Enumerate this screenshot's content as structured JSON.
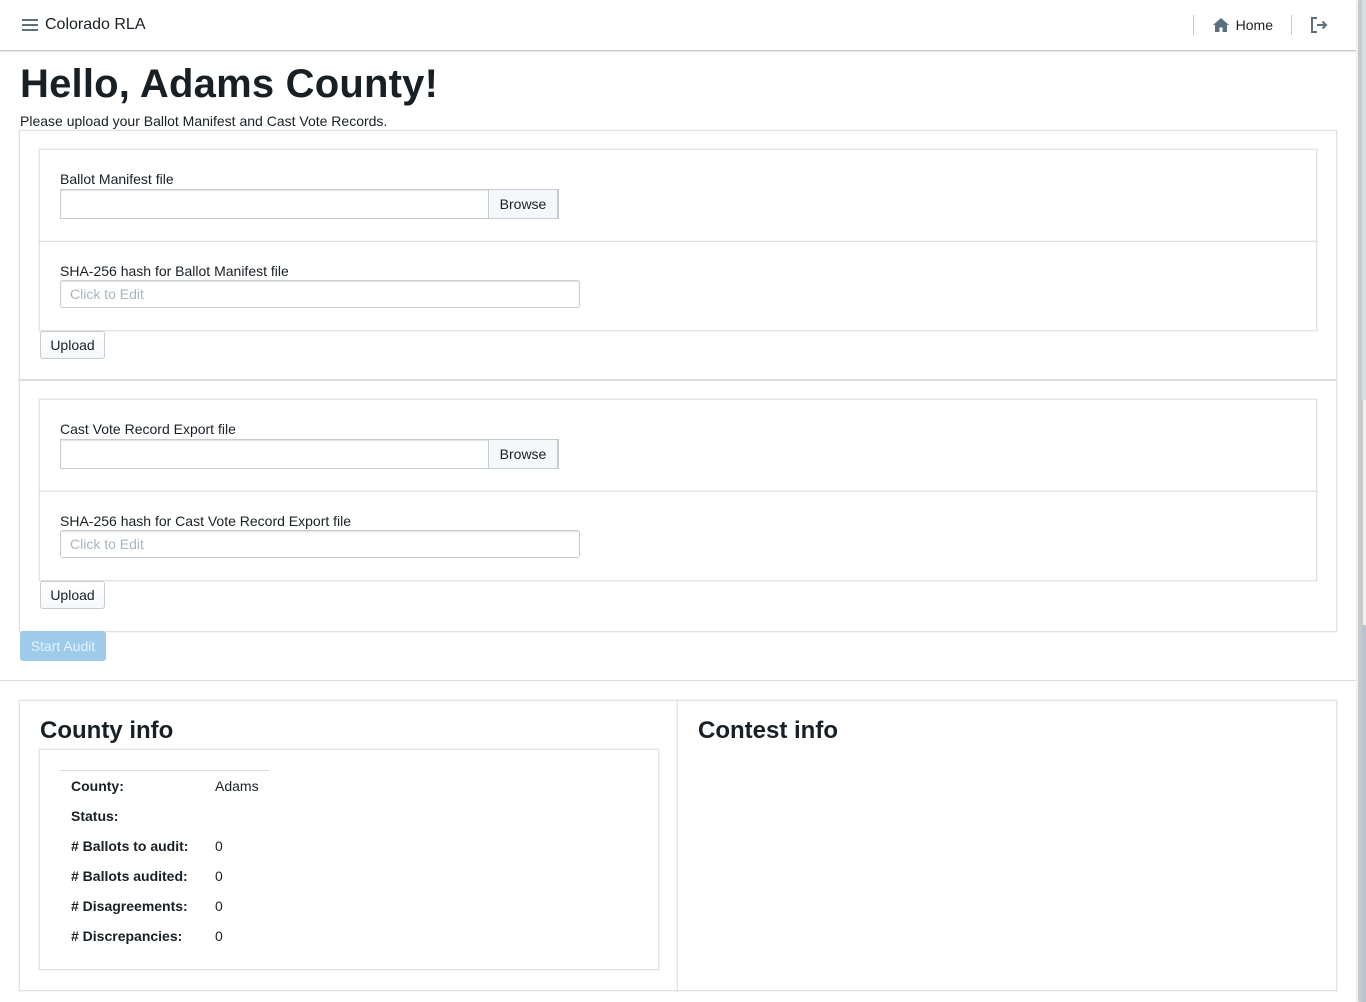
{
  "nav": {
    "title": "Colorado RLA",
    "home_label": "Home",
    "menu_icon": "menu-icon",
    "home_icon": "home-icon",
    "logout_icon": "log-out-icon"
  },
  "greeting": "Hello, Adams County!",
  "intro": "Please upload your Ballot Manifest and Cast Vote Records.",
  "ballot_manifest": {
    "file_label": "Ballot Manifest file",
    "browse_label": "Browse",
    "hash_label": "SHA-256 hash for Ballot Manifest file",
    "hash_placeholder": "Click to Edit",
    "upload_label": "Upload"
  },
  "cvr": {
    "file_label": "Cast Vote Record Export file",
    "browse_label": "Browse",
    "hash_label": "SHA-256 hash for Cast Vote Record Export file",
    "hash_placeholder": "Click to Edit",
    "upload_label": "Upload"
  },
  "start_audit_label": "Start Audit",
  "county_info": {
    "title": "County info",
    "rows": [
      {
        "key": "County:",
        "value": "Adams"
      },
      {
        "key": "Status:",
        "value": ""
      },
      {
        "key": "# Ballots to audit:",
        "value": "0"
      },
      {
        "key": "# Ballots audited:",
        "value": "0"
      },
      {
        "key": "# Disagreements:",
        "value": "0"
      },
      {
        "key": "# Discrepancies:",
        "value": "0"
      }
    ]
  },
  "contest_info": {
    "title": "Contest info"
  },
  "colors": {
    "primary_disabled": "#9fcbea",
    "icon": "#5c7080",
    "text": "#182026"
  }
}
